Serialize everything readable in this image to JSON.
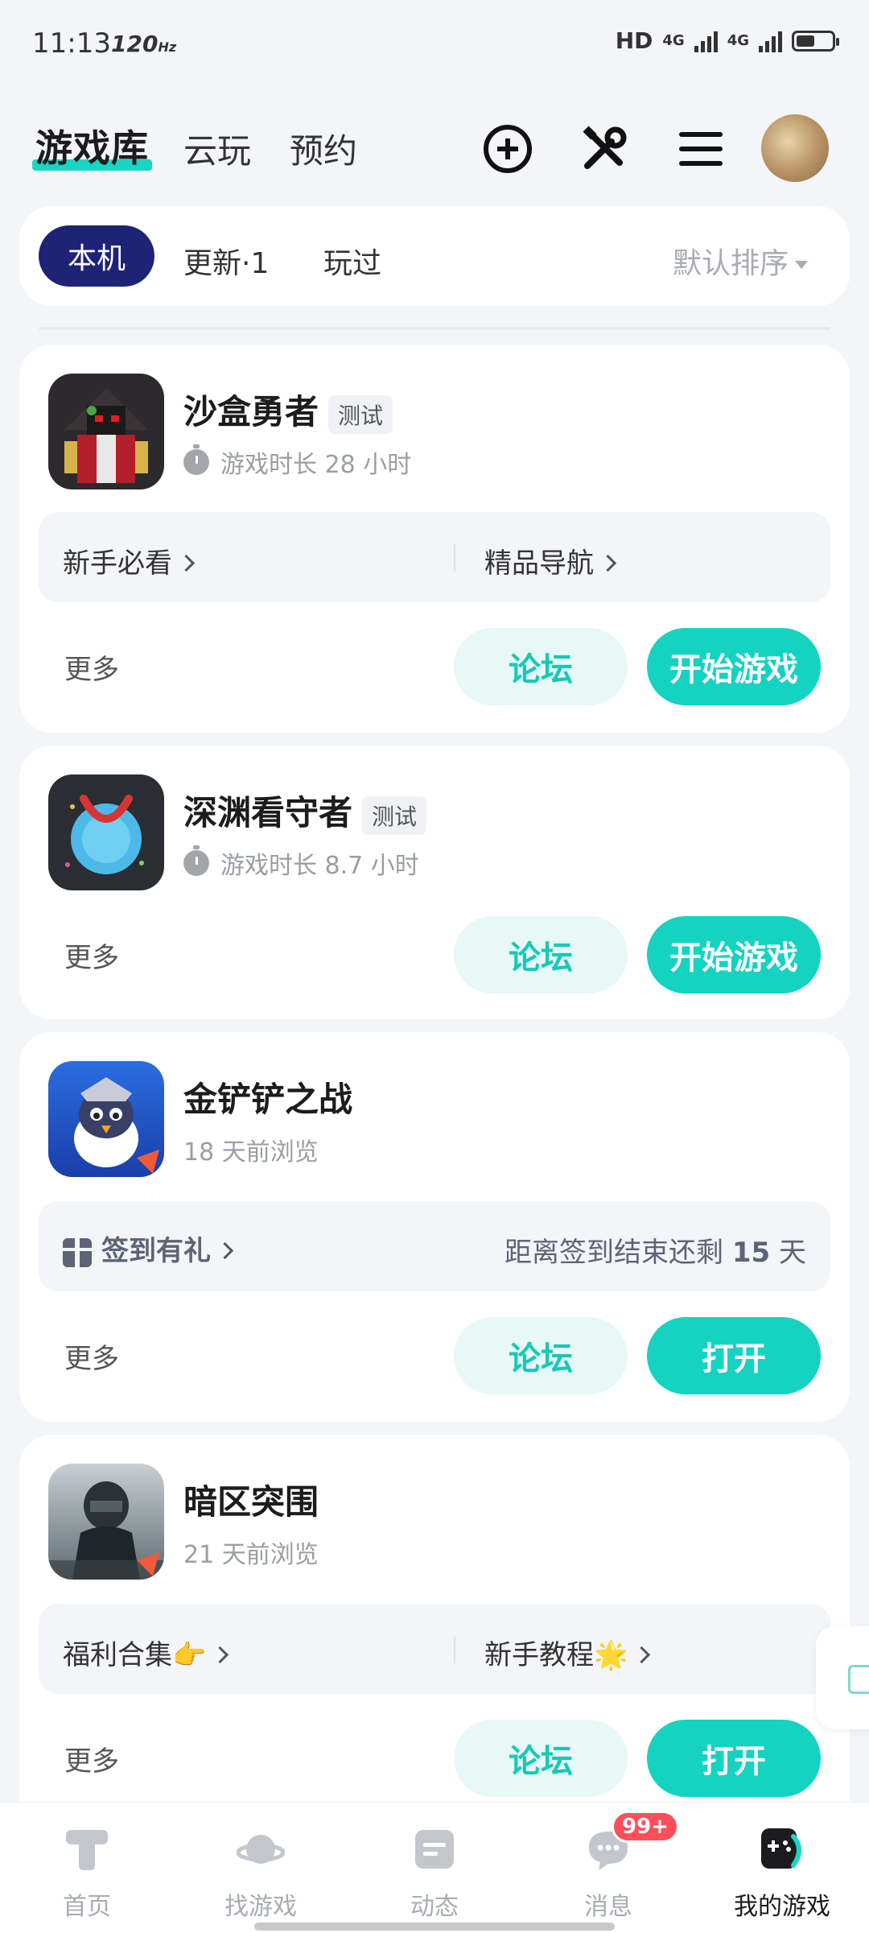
{
  "status_bar": {
    "time": "11:13",
    "refresh": "120",
    "refresh_unit": "Hz",
    "hd": "HD",
    "net1": "4G",
    "net2": "4G"
  },
  "header": {
    "tabs": [
      {
        "label": "游戏库"
      },
      {
        "label": "云玩"
      },
      {
        "label": "预约"
      }
    ],
    "icons": [
      "add-circle-icon",
      "tools-icon",
      "menu-icon"
    ],
    "accent": "#17d7c2"
  },
  "filter": {
    "chips": [
      {
        "label": "本机"
      },
      {
        "label": "更新·1"
      },
      {
        "label": "玩过"
      }
    ],
    "sort_label": "默认排序"
  },
  "games": [
    {
      "name": "沙盒勇者",
      "tag": "测试",
      "subtitle": "游戏时长 28 小时",
      "links": [
        "新手必看",
        "精品导航"
      ],
      "more": "更多",
      "forum": "论坛",
      "action": "开始游戏"
    },
    {
      "name": "深渊看守者",
      "tag": "测试",
      "subtitle": "游戏时长 8.7 小时",
      "more": "更多",
      "forum": "论坛",
      "action": "开始游戏"
    },
    {
      "name": "金铲铲之战",
      "subtitle": "18 天前浏览",
      "signin_label": "签到有礼",
      "signin_info_prefix": "距离签到结束还剩",
      "signin_days": "15",
      "signin_info_suffix": "天",
      "more": "更多",
      "forum": "论坛",
      "action": "打开"
    },
    {
      "name": "暗区突围",
      "subtitle": "21 天前浏览",
      "links": [
        "福利合集👉",
        "新手教程🌟"
      ],
      "more": "更多",
      "forum": "论坛",
      "action": "打开"
    }
  ],
  "bottom_nav": [
    {
      "label": "首页",
      "icon": "home-icon"
    },
    {
      "label": "找游戏",
      "icon": "planet-icon"
    },
    {
      "label": "动态",
      "icon": "feed-icon"
    },
    {
      "label": "消息",
      "icon": "message-icon",
      "badge": "99+"
    },
    {
      "label": "我的游戏",
      "icon": "gamepad-icon",
      "active": true
    }
  ],
  "colors": {
    "primary": "#14d3c0",
    "forum_bg": "#e7f8f6",
    "chip_active": "#1f2375",
    "badge": "#ff4f5a"
  }
}
